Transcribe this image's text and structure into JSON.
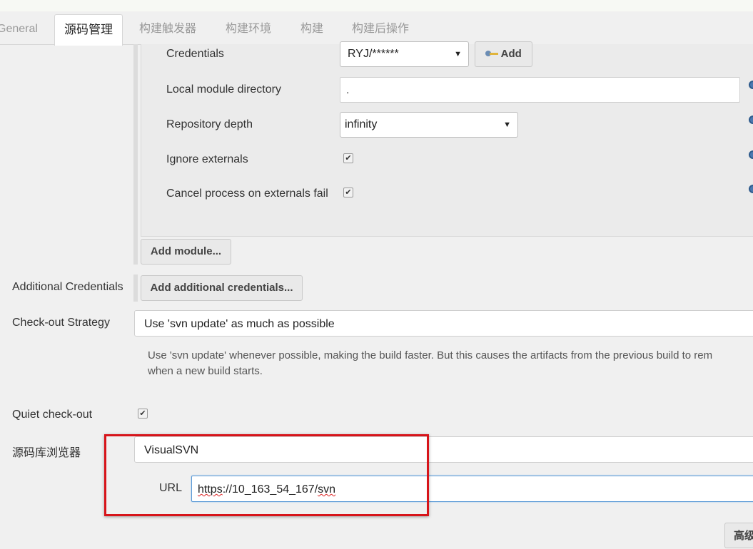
{
  "tabs": [
    {
      "label": "General",
      "active": false
    },
    {
      "label": "源码管理",
      "active": true
    },
    {
      "label": "构建触发器",
      "active": false
    },
    {
      "label": "构建环境",
      "active": false
    },
    {
      "label": "构建",
      "active": false
    },
    {
      "label": "构建后操作",
      "active": false
    }
  ],
  "module": {
    "credentials_label": "Credentials",
    "credentials_value": "RYJ/******",
    "add_label": "Add",
    "local_dir_label": "Local module directory",
    "local_dir_value": ".",
    "depth_label": "Repository depth",
    "depth_value": "infinity",
    "ignore_externals_label": "Ignore externals",
    "ignore_externals_checked": true,
    "cancel_externals_label": "Cancel process on externals fail",
    "cancel_externals_checked": true,
    "add_module_label": "Add module..."
  },
  "additional_credentials": {
    "label": "Additional Credentials",
    "button_label": "Add additional credentials..."
  },
  "checkout_strategy": {
    "label": "Check-out Strategy",
    "value": "Use 'svn update' as much as possible",
    "description_line1": "Use 'svn update' whenever possible, making the build faster. But this causes the artifacts from the previous build to rem",
    "description_line2": "when a new build starts."
  },
  "quiet_checkout": {
    "label": "Quiet check-out",
    "checked": true
  },
  "repo_browser": {
    "label": "源码库浏览器",
    "value": "VisualSVN",
    "url_label": "URL",
    "url_part1": "https",
    "url_part2": "://10_163_54_167/",
    "url_part3": "svn"
  },
  "advanced_label": "高级",
  "colors": {
    "highlight_box": "#d7141a",
    "help_icon": "#4a78b0"
  }
}
